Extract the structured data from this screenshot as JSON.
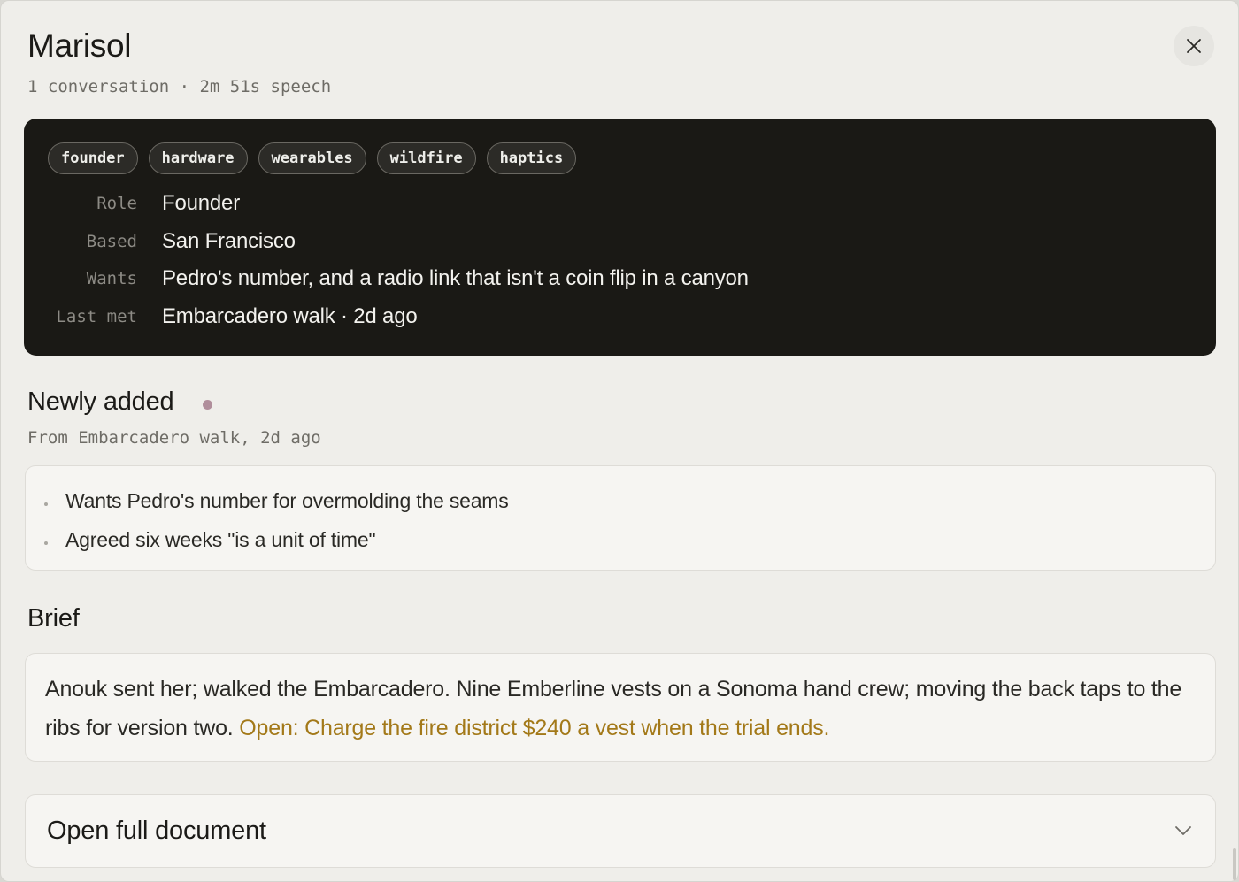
{
  "header": {
    "name": "Marisol",
    "subtitle": "1 conversation · 2m 51s speech"
  },
  "icons": {
    "close": "close-icon",
    "chevron": "chevron-down-icon"
  },
  "profile": {
    "tags": [
      "founder",
      "hardware",
      "wearables",
      "wildfire",
      "haptics"
    ],
    "fields": [
      {
        "label": "Role",
        "value": "Founder"
      },
      {
        "label": "Based",
        "value": "San Francisco"
      },
      {
        "label": "Wants",
        "value": "Pedro's number, and a radio link that isn't a coin flip in a canyon"
      },
      {
        "label": "Last met",
        "value": "Embarcadero walk · 2d ago"
      }
    ]
  },
  "newly_added": {
    "title": "Newly added",
    "source": "From Embarcadero walk, 2d ago",
    "items": [
      "Wants Pedro's number for overmolding the seams",
      "Agreed six weeks \"is a unit of time\""
    ]
  },
  "brief": {
    "title": "Brief",
    "text": "Anouk sent her; walked the Embarcadero. Nine Emberline vests on a Sonoma hand crew; moving the back taps to the ribs for version two. ",
    "open_item": "Open: Charge the fire district $240 a vest when the trial ends."
  },
  "actions": {
    "open_full_document": "Open full document"
  },
  "colors": {
    "dark_card": "#1a1915",
    "accent_open": "#a37919",
    "dot": "#b08e9b",
    "background": "#efeeea"
  }
}
